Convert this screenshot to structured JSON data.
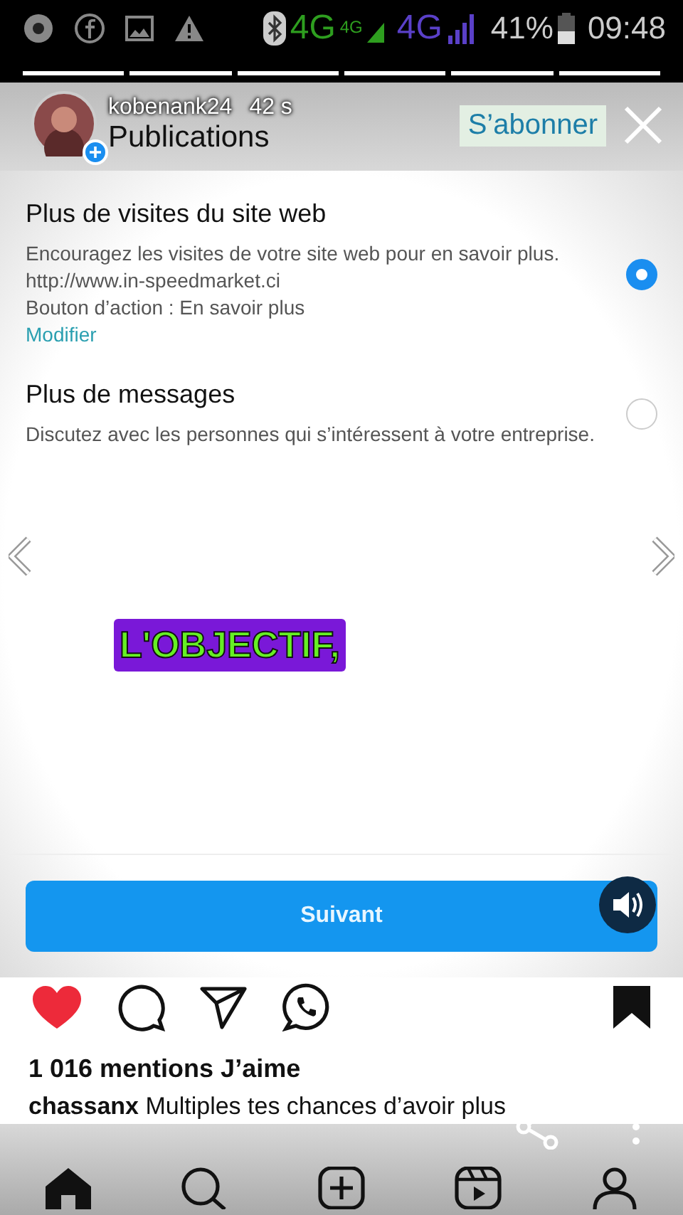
{
  "status_bar": {
    "network_1": "4G",
    "network_1_small": "4G",
    "network_2": "4G",
    "battery": "41%",
    "time": "09:48"
  },
  "story": {
    "username": "kobenank24",
    "time": "42 s",
    "follow": "S’abonner"
  },
  "screen": {
    "title": "Publications",
    "options": [
      {
        "title": "Plus de visites du site web",
        "lines": [
          "Encouragez les visites de votre site web pour en savoir plus.",
          "http://www.in-speedmarket.ci",
          "Bouton d’action : En savoir plus"
        ],
        "link": "Modifier",
        "selected": true
      },
      {
        "title": "Plus de messages",
        "lines": [
          "Discutez avec les personnes qui s’intéressent à votre entreprise."
        ],
        "selected": false
      }
    ],
    "sticker": "L'OBJECTIF,",
    "next_button": "Suivant"
  },
  "post": {
    "likes": "1 016 mentions J’aime",
    "caption_user": "chassanx",
    "caption": "Multiples tes chances d’avoir plus"
  }
}
